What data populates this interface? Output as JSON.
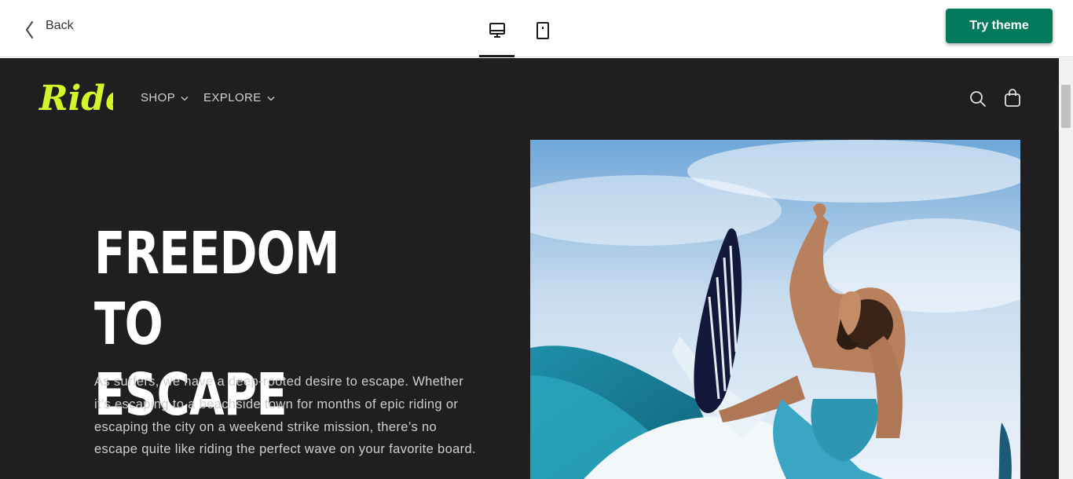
{
  "toolbar": {
    "back_label": "Back",
    "try_label": "Try theme",
    "active_view": "desktop",
    "accent_color": "#047a5c"
  },
  "store": {
    "logo_text": "Ride",
    "logo_color": "#d4f52b",
    "nav": [
      {
        "label": "SHOP"
      },
      {
        "label": "EXPLORE"
      }
    ],
    "hero": {
      "heading_line1": "FREEDOM TO",
      "heading_line2": "ESCAPE",
      "body": "As surfers, we have a deep-rooted desire to escape. Whether it's escaping to a beachside town for months of epic riding or escaping the city on a weekend strike mission, there’s no escape quite like riding the perfect wave on your favorite board."
    },
    "background_color": "#1f1f21"
  }
}
